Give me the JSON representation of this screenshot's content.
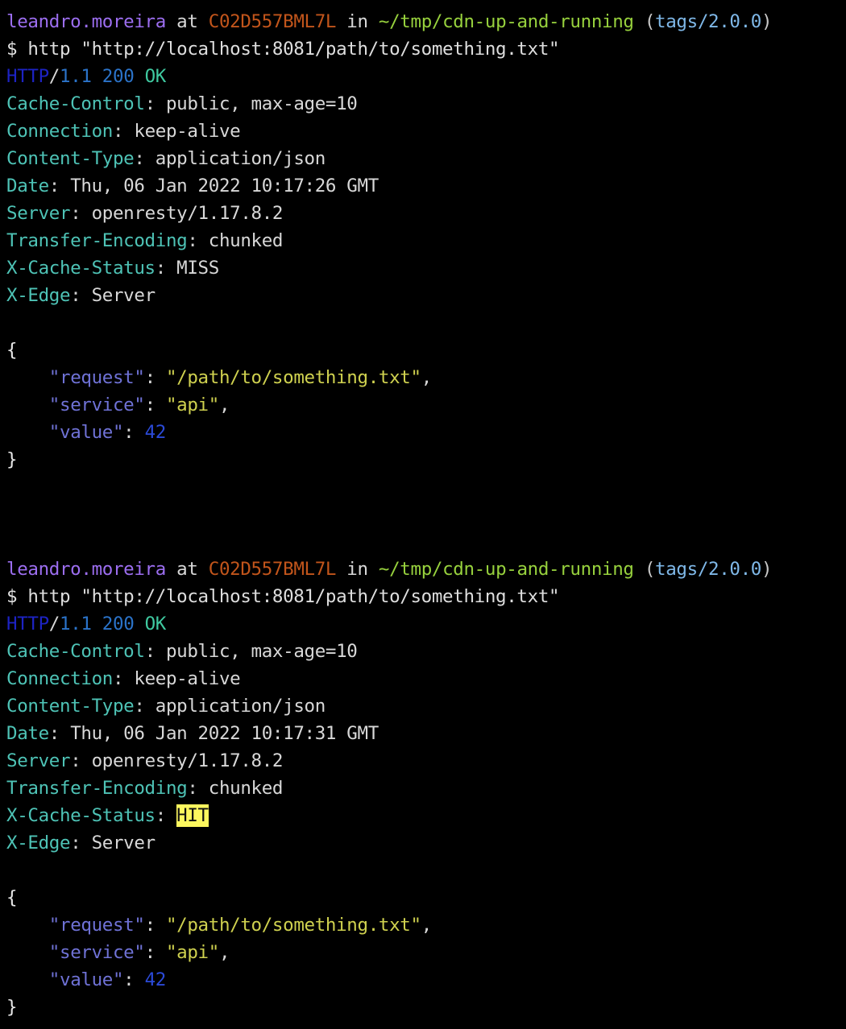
{
  "terminal": {
    "background_color": "#000000",
    "foreground_color": "#d6d6d6",
    "colors": {
      "user": "#9c6ef0",
      "host": "#c2551b",
      "path": "#97d13d",
      "branch": "#7fb8e8",
      "header_name": "#4ec3b6",
      "json_key": "#6f72d6",
      "json_string": "#cfd14f",
      "json_number": "#2b4ad8",
      "status_protocol": "#1d23c4",
      "status_code": "#2b73c9",
      "status_reason": "#3fc9a0",
      "highlight_bg": "#fcf75e",
      "highlight_fg": "#101010"
    }
  },
  "blocks": [
    {
      "prompt": {
        "user": "leandro.moreira",
        "at": " at ",
        "host": "C02D557BML7L",
        "in": " in ",
        "path": "~/tmp/cdn-up-and-running",
        "space": " ",
        "paren_open": "(",
        "branch": "tags/2.0.0",
        "paren_close": ")"
      },
      "command": {
        "sigil": "$ ",
        "text": "http \"http://localhost:8081/path/to/something.txt\""
      },
      "status": {
        "protocol": "HTTP",
        "slash": "/",
        "version": "1.1",
        "space": " ",
        "code": "200",
        "reason": " OK"
      },
      "headers": [
        {
          "name": "Cache-Control",
          "value": "public, max-age=10",
          "highlight": false
        },
        {
          "name": "Connection",
          "value": "keep-alive",
          "highlight": false
        },
        {
          "name": "Content-Type",
          "value": "application/json",
          "highlight": false
        },
        {
          "name": "Date",
          "value": "Thu, 06 Jan 2022 10:17:26 GMT",
          "highlight": false
        },
        {
          "name": "Server",
          "value": "openresty/1.17.8.2",
          "highlight": false
        },
        {
          "name": "Transfer-Encoding",
          "value": "chunked",
          "highlight": false
        },
        {
          "name": "X-Cache-Status",
          "value": "MISS",
          "highlight": false
        },
        {
          "name": "X-Edge",
          "value": "Server",
          "highlight": false
        }
      ],
      "body": {
        "open_brace": "{",
        "close_brace": "}",
        "entries": [
          {
            "key": "\"request\"",
            "colon": ": ",
            "value": "\"/path/to/something.txt\"",
            "value_type": "string",
            "comma": ","
          },
          {
            "key": "\"service\"",
            "colon": ": ",
            "value": "\"api\"",
            "value_type": "string",
            "comma": ","
          },
          {
            "key": "\"value\"",
            "colon": ": ",
            "value": "42",
            "value_type": "number",
            "comma": ""
          }
        ]
      }
    },
    {
      "prompt": {
        "user": "leandro.moreira",
        "at": " at ",
        "host": "C02D557BML7L",
        "in": " in ",
        "path": "~/tmp/cdn-up-and-running",
        "space": " ",
        "paren_open": "(",
        "branch": "tags/2.0.0",
        "paren_close": ")"
      },
      "command": {
        "sigil": "$ ",
        "text": "http \"http://localhost:8081/path/to/something.txt\""
      },
      "status": {
        "protocol": "HTTP",
        "slash": "/",
        "version": "1.1",
        "space": " ",
        "code": "200",
        "reason": " OK"
      },
      "headers": [
        {
          "name": "Cache-Control",
          "value": "public, max-age=10",
          "highlight": false
        },
        {
          "name": "Connection",
          "value": "keep-alive",
          "highlight": false
        },
        {
          "name": "Content-Type",
          "value": "application/json",
          "highlight": false
        },
        {
          "name": "Date",
          "value": "Thu, 06 Jan 2022 10:17:31 GMT",
          "highlight": false
        },
        {
          "name": "Server",
          "value": "openresty/1.17.8.2",
          "highlight": false
        },
        {
          "name": "Transfer-Encoding",
          "value": "chunked",
          "highlight": false
        },
        {
          "name": "X-Cache-Status",
          "value": "HIT",
          "highlight": true
        },
        {
          "name": "X-Edge",
          "value": "Server",
          "highlight": false
        }
      ],
      "body": {
        "open_brace": "{",
        "close_brace": "}",
        "entries": [
          {
            "key": "\"request\"",
            "colon": ": ",
            "value": "\"/path/to/something.txt\"",
            "value_type": "string",
            "comma": ","
          },
          {
            "key": "\"service\"",
            "colon": ": ",
            "value": "\"api\"",
            "value_type": "string",
            "comma": ","
          },
          {
            "key": "\"value\"",
            "colon": ": ",
            "value": "42",
            "value_type": "number",
            "comma": ""
          }
        ]
      }
    }
  ],
  "separator_blank_lines": 3,
  "body_indent": "    "
}
